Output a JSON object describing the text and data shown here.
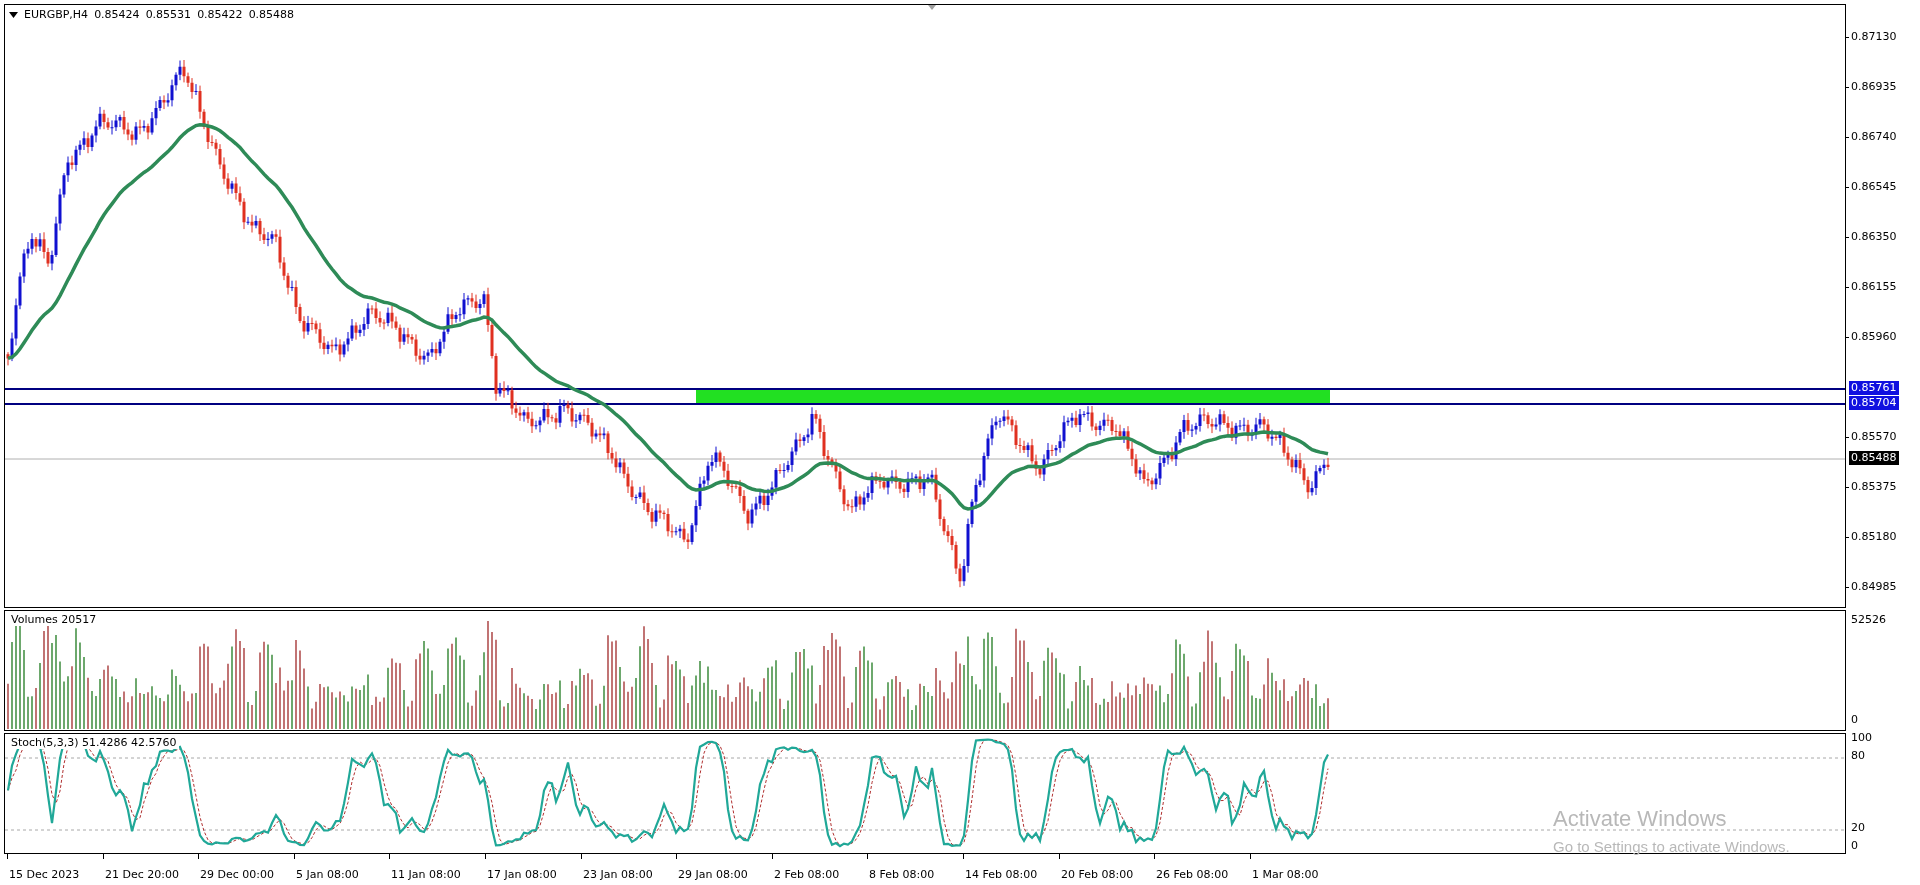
{
  "chart": {
    "symbol": "EURGBP,H4",
    "ohlc": [
      "0.85424",
      "0.85531",
      "0.85422",
      "0.85488"
    ],
    "price_axis": [
      "0.87130",
      "0.86935",
      "0.86740",
      "0.86545",
      "0.86350",
      "0.86155",
      "0.85960",
      "0.85570",
      "0.85375",
      "0.85180",
      "0.84985"
    ],
    "levels": [
      {
        "label": "0.85761"
      },
      {
        "label": "0.85704"
      }
    ],
    "current_price": "0.85488"
  },
  "volumes": {
    "title": "Volumes 20517",
    "axis": [
      "52526",
      "0"
    ]
  },
  "stochastic": {
    "title": "Stoch(5,3,3) 51.4286 42.5760",
    "axis": [
      "100",
      "80",
      "20",
      "0"
    ]
  },
  "time_axis": [
    "15 Dec 2023",
    "21 Dec 20:00",
    "29 Dec 00:00",
    "5 Jan 08:00",
    "11 Jan 08:00",
    "17 Jan 08:00",
    "23 Jan 08:00",
    "29 Jan 08:00",
    "2 Feb 08:00",
    "8 Feb 08:00",
    "14 Feb 08:00",
    "20 Feb 08:00",
    "26 Feb 08:00",
    "1 Mar 08:00"
  ],
  "activation_notice": {
    "title": "Activate Windows",
    "text": "Go to Settings to activate Windows."
  }
}
